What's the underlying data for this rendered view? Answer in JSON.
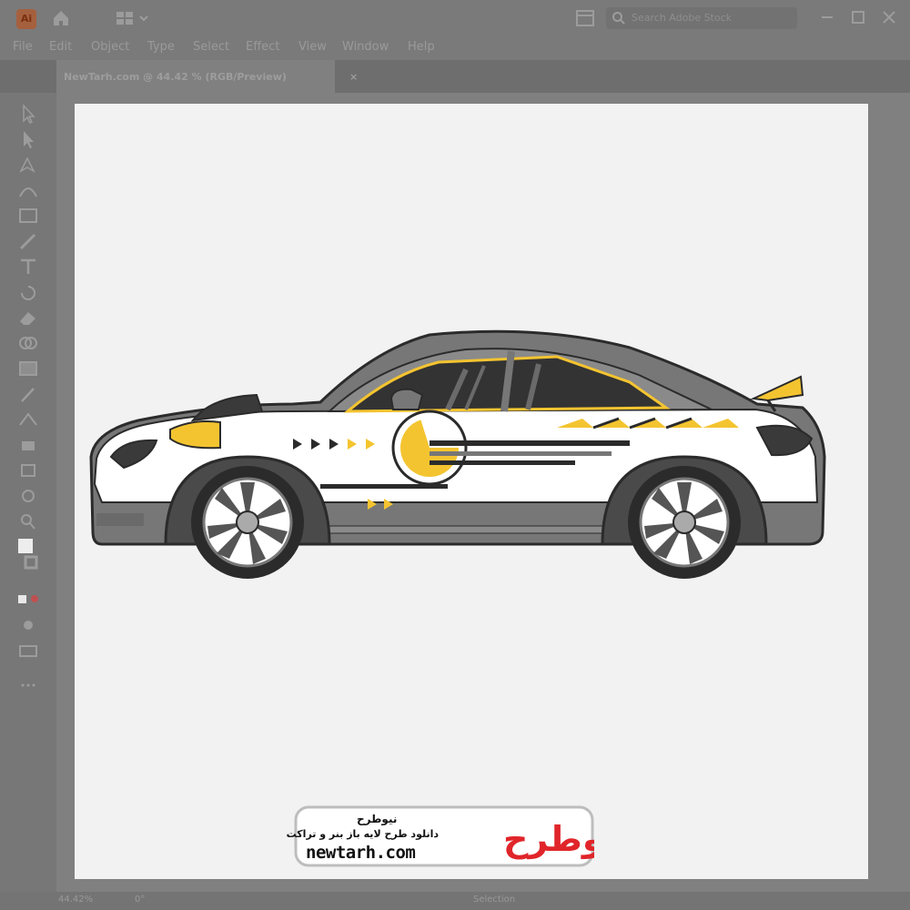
{
  "app": {
    "logo_text": "Ai",
    "search_placeholder": "Search Adobe Stock"
  },
  "menu": [
    "File",
    "Edit",
    "Object",
    "Type",
    "Select",
    "Effect",
    "View",
    "Window",
    "Help"
  ],
  "document": {
    "tab_title": "NewTarh.com @ 44.42 % (RGB/Preview)",
    "close_glyph": "×"
  },
  "status": {
    "zoom": "44.42%",
    "rotation": "0°",
    "mode": "Selection"
  },
  "watermark": {
    "brand_fa": "نیوطرح",
    "tagline_fa": "دانلود طرح لایه باز بنر و تراکت",
    "url": "newtarh.com",
    "logo_text": "نیوطرح"
  },
  "icons": [
    "home-icon",
    "layout-icon",
    "panel-icon",
    "search-icon",
    "minimize-icon",
    "maximize-icon",
    "close-icon"
  ],
  "colors": {
    "accent_yellow": "#f4c430",
    "car_gray": "#777777",
    "dark": "#2b2b2b",
    "watermark_red": "#e0252a"
  }
}
